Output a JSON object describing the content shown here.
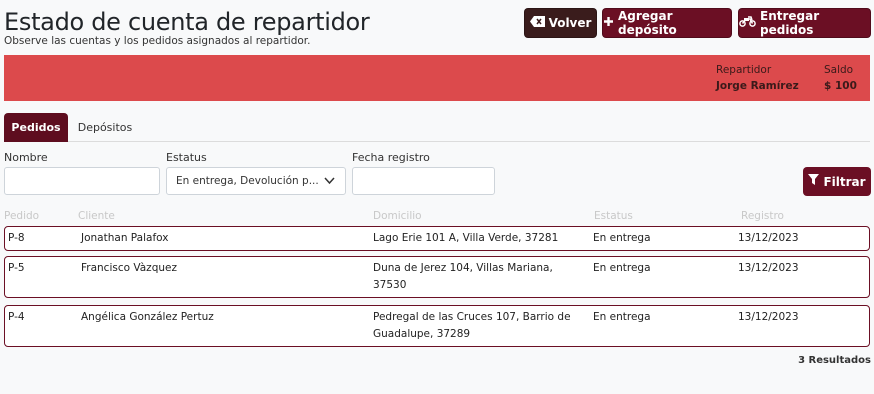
{
  "header": {
    "title": "Estado de cuenta de repartidor",
    "subtitle": "Observe las cuentas y los pedidos asignados al repartidor."
  },
  "toolbar": {
    "back_label": "Volver",
    "add_deposit_label": "Agregar depósito",
    "deliver_label": "Entregar pedidos"
  },
  "summary": {
    "courier_label": "Repartidor",
    "courier_name": "Jorge Ramírez",
    "balance_label": "Saldo",
    "balance_value": "$ 100",
    "accent_color": "#dc4a4c"
  },
  "tabs": [
    {
      "label": "Pedidos",
      "active": true
    },
    {
      "label": "Depósitos",
      "active": false
    }
  ],
  "filters": {
    "name_label": "Nombre",
    "name_value": "",
    "status_label": "Estatus",
    "status_value": "En entrega, Devolución p...",
    "date_label": "Fecha registro",
    "date_value": "",
    "filter_button": "Filtrar"
  },
  "table": {
    "columns": [
      "Pedido",
      "Cliente",
      "Domicilio",
      "Estatus",
      "Registro"
    ],
    "rows": [
      {
        "id": "P-8",
        "client": "Jonathan Palafox",
        "address_1": "Lago Erie 101 A, Villa Verde, 37281",
        "address_2": "",
        "status": "En entrega",
        "date": "13/12/2023"
      },
      {
        "id": "P-5",
        "client": "Francisco Vàzquez",
        "address_1": "Duna de Jerez 104, Villas Mariana,",
        "address_2": "37530",
        "status": "En entrega",
        "date": "13/12/2023"
      },
      {
        "id": "P-4",
        "client": "Angélica González Pertuz",
        "address_1": "Pedregal de las Cruces 107, Barrio de",
        "address_2": "Guadalupe, 37289",
        "status": "En entrega",
        "date": "13/12/2023"
      }
    ]
  },
  "footer": {
    "results": "3 Resultados"
  }
}
